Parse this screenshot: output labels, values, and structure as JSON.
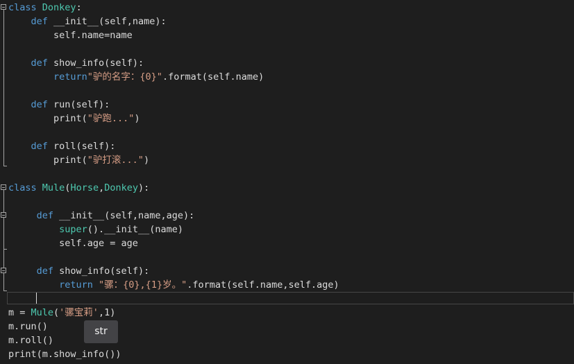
{
  "editor": {
    "lines": [
      {
        "tokens": [
          {
            "t": "class ",
            "c": "kw"
          },
          {
            "t": "Donkey",
            "c": "cls"
          },
          {
            "t": ":",
            "c": "id"
          }
        ]
      },
      {
        "tokens": [
          {
            "t": "    def ",
            "c": "kw"
          },
          {
            "t": "__init__",
            "c": "id"
          },
          {
            "t": "(self,name):",
            "c": "id"
          }
        ]
      },
      {
        "tokens": [
          {
            "t": "        self.name=name",
            "c": "id"
          }
        ]
      },
      {
        "tokens": []
      },
      {
        "tokens": [
          {
            "t": "    def ",
            "c": "kw"
          },
          {
            "t": "show_info(self):",
            "c": "id"
          }
        ]
      },
      {
        "tokens": [
          {
            "t": "        return",
            "c": "kw"
          },
          {
            "t": "\"驴的名字：{0}\"",
            "c": "str"
          },
          {
            "t": ".format(self.name)",
            "c": "id"
          }
        ]
      },
      {
        "tokens": []
      },
      {
        "tokens": [
          {
            "t": "    def ",
            "c": "kw"
          },
          {
            "t": "run(self):",
            "c": "id"
          }
        ]
      },
      {
        "tokens": [
          {
            "t": "        print(",
            "c": "id"
          },
          {
            "t": "\"驴跑...\"",
            "c": "str"
          },
          {
            "t": ")",
            "c": "id"
          }
        ]
      },
      {
        "tokens": []
      },
      {
        "tokens": [
          {
            "t": "    def ",
            "c": "kw"
          },
          {
            "t": "roll(self):",
            "c": "id"
          }
        ]
      },
      {
        "tokens": [
          {
            "t": "        print(",
            "c": "id"
          },
          {
            "t": "\"驴打滚...\"",
            "c": "str"
          },
          {
            "t": ")",
            "c": "id"
          }
        ]
      },
      {
        "tokens": []
      },
      {
        "tokens": [
          {
            "t": "class ",
            "c": "kw"
          },
          {
            "t": "Mule",
            "c": "cls"
          },
          {
            "t": "(",
            "c": "id"
          },
          {
            "t": "Horse",
            "c": "cls"
          },
          {
            "t": ",",
            "c": "id"
          },
          {
            "t": "Donkey",
            "c": "cls"
          },
          {
            "t": "):",
            "c": "id"
          }
        ]
      },
      {
        "tokens": []
      },
      {
        "tokens": [
          {
            "t": "     def ",
            "c": "kw"
          },
          {
            "t": "__init__",
            "c": "id"
          },
          {
            "t": "(self,name,age):",
            "c": "id"
          }
        ]
      },
      {
        "tokens": [
          {
            "t": "         super",
            "c": "cls"
          },
          {
            "t": "().__init__(name)",
            "c": "id"
          }
        ]
      },
      {
        "tokens": [
          {
            "t": "         self.age = age",
            "c": "id"
          }
        ]
      },
      {
        "tokens": []
      },
      {
        "tokens": [
          {
            "t": "     def ",
            "c": "kw"
          },
          {
            "t": "show_info(self):",
            "c": "id"
          }
        ]
      },
      {
        "tokens": [
          {
            "t": "         return ",
            "c": "kw"
          },
          {
            "t": "\"骡：{0},{1}岁。\"",
            "c": "str"
          },
          {
            "t": ".format(self.name,self.age)",
            "c": "id"
          }
        ]
      },
      {
        "tokens": []
      },
      {
        "tokens": [
          {
            "t": "m = ",
            "c": "id"
          },
          {
            "t": "Mule",
            "c": "cls"
          },
          {
            "t": "(",
            "c": "id"
          },
          {
            "t": "'骡宝莉'",
            "c": "str"
          },
          {
            "t": ",1)",
            "c": "id"
          }
        ]
      },
      {
        "tokens": [
          {
            "t": "m.run()",
            "c": "id"
          }
        ]
      },
      {
        "tokens": [
          {
            "t": "m.roll()",
            "c": "id"
          }
        ]
      },
      {
        "tokens": [
          {
            "t": "print(m.show_info())",
            "c": "id"
          }
        ]
      }
    ]
  },
  "tooltip": {
    "text": "str"
  },
  "colors": {
    "background": "#1e1e1e",
    "keyword": "#569cd6",
    "class": "#4ec9b0",
    "string": "#d69d85",
    "text": "#dcdcdc"
  }
}
